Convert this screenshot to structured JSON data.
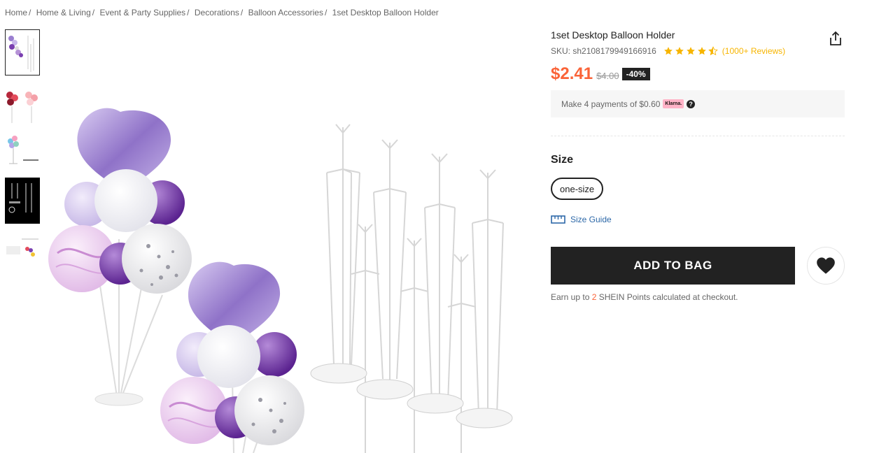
{
  "breadcrumb": {
    "items": [
      "Home",
      "Home & Living",
      "Event & Party Supplies",
      "Decorations",
      "Balloon Accessories"
    ],
    "current": "1set Desktop Balloon Holder",
    "separator": "/"
  },
  "product": {
    "title": "1set Desktop Balloon Holder",
    "sku": "SKU: sh2108179949166916",
    "rating": 4.5,
    "reviews": "(1000+ Reviews)",
    "price": "$2.41",
    "original_price": "$4.00",
    "discount": "-40%"
  },
  "klarna": {
    "text": "Make 4 payments of $0.60",
    "badge": "Klarna.",
    "help": "?"
  },
  "size": {
    "label": "Size",
    "options": [
      "one-size"
    ],
    "selected": "one-size",
    "guide_label": "Size Guide"
  },
  "actions": {
    "add_to_bag": "ADD TO BAG",
    "wishlist_icon": "heart-icon",
    "share_icon": "share-icon"
  },
  "points": {
    "prefix": "Earn up to ",
    "count": "2",
    "suffix": " SHEIN Points calculated at checkout."
  },
  "colors": {
    "accent": "#fa6338",
    "star": "#f7b500",
    "link": "#2d68a8",
    "button": "#222222",
    "balloon_purple": "#7a3fb0",
    "balloon_lilac": "#b9a6e0"
  }
}
